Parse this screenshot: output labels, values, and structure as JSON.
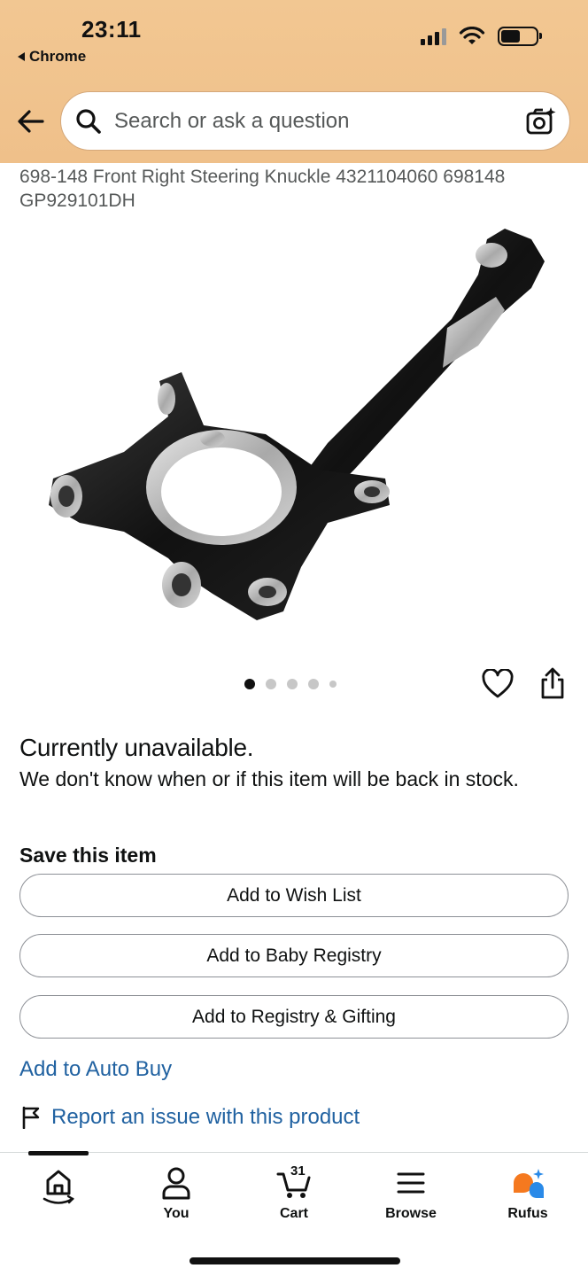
{
  "status_bar": {
    "time": "23:11",
    "back_app": "Chrome"
  },
  "search": {
    "placeholder": "Search or ask a question"
  },
  "product": {
    "title": "698-148 Front Right Steering Knuckle 4321104060 698148 GP929101DH",
    "image_count": 5,
    "active_image": 1
  },
  "availability": {
    "heading": "Currently unavailable.",
    "message": "We don't know when or if this item will be back in stock."
  },
  "save": {
    "heading": "Save this item",
    "wish_list": "Add to Wish List",
    "baby_registry": "Add to Baby Registry",
    "registry_gifting": "Add to Registry & Gifting"
  },
  "links": {
    "auto_buy": "Add to Auto Buy",
    "report": "Report an issue with this product"
  },
  "bottom_nav": {
    "you": "You",
    "cart": "Cart",
    "cart_count": "31",
    "browse": "Browse",
    "rufus": "Rufus"
  },
  "colors": {
    "header_bg": "#f2c792",
    "link": "#2162a1",
    "rufus_orange": "#f5791f",
    "rufus_blue": "#2a8ae8"
  }
}
